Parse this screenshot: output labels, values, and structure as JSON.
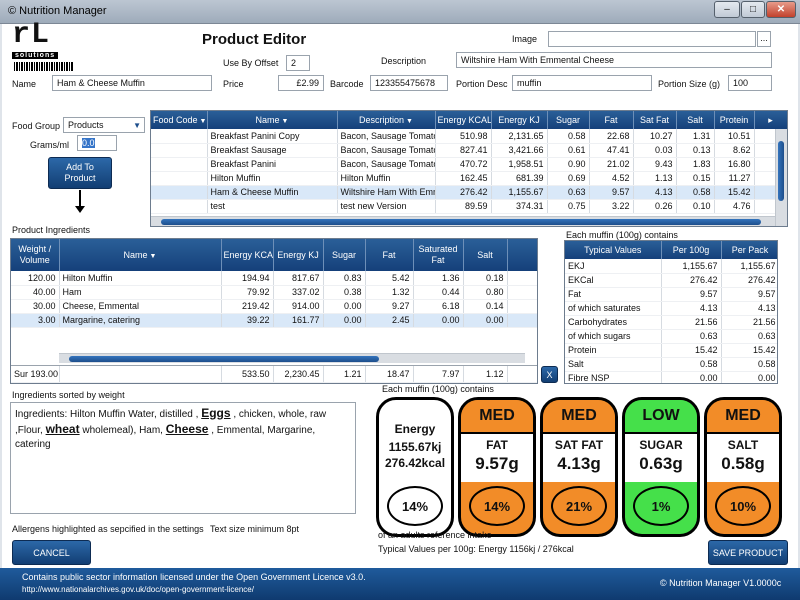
{
  "window": {
    "title": "© Nutrition Manager",
    "min": "–",
    "max": "□",
    "close": "✕"
  },
  "header": {
    "title": "Product Editor",
    "logo_main": "rL",
    "logo_sub": "solutions"
  },
  "form": {
    "image_label": "Image",
    "image_value": "",
    "image_btn": "...",
    "use_by_label": "Use By Offset",
    "use_by_value": "2",
    "description_label": "Description",
    "description_value": "Wiltshire Ham With Emmental Cheese",
    "name_label": "Name",
    "name_value": "Ham & Cheese Muffin",
    "price_label": "Price",
    "price_value": "£2.99",
    "barcode_label": "Barcode",
    "barcode_value": "123355475678",
    "portion_desc_label": "Portion Desc",
    "portion_desc_value": "muffin",
    "portion_size_label": "Portion Size (g)",
    "portion_size_value": "100",
    "food_group_label": "Food Group",
    "food_group_value": "Products",
    "grams_label": "Grams/ml",
    "grams_value": "0.0",
    "add_btn": "Add To Product"
  },
  "products_grid": {
    "columns": [
      "Food Code",
      "Name",
      "Description",
      "Energy KCAL",
      "Energy KJ",
      "Sugar",
      "Fat",
      "Sat Fat",
      "Salt",
      "Protein"
    ],
    "rows": [
      [
        "",
        "Breakfast Panini Copy",
        "Bacon, Sausage Tomato",
        "510.98",
        "2,131.65",
        "0.58",
        "22.68",
        "10.27",
        "1.31",
        "10.51"
      ],
      [
        "",
        "Breakfast Sausage",
        "Bacon, Sausage Tomato",
        "827.41",
        "3,421.66",
        "0.61",
        "47.41",
        "0.03",
        "0.13",
        "8.62"
      ],
      [
        "",
        "Breakfast Panini",
        "Bacon, Sausage Tomato",
        "470.72",
        "1,958.51",
        "0.90",
        "21.02",
        "9.43",
        "1.83",
        "16.80"
      ],
      [
        "",
        "Hilton Muffin",
        "Hilton Muffin",
        "162.45",
        "681.39",
        "0.69",
        "4.52",
        "1.13",
        "0.15",
        "11.27"
      ],
      [
        "",
        "Ham & Cheese Muffin",
        "Wiltshire Ham With Emn",
        "276.42",
        "1,155.67",
        "0.63",
        "9.57",
        "4.13",
        "0.58",
        "15.42"
      ],
      [
        "",
        "test",
        "test new Version",
        "89.59",
        "374.31",
        "0.75",
        "3.22",
        "0.26",
        "0.10",
        "4.76"
      ]
    ],
    "selected_row": 4
  },
  "ingredients": {
    "section_label": "Product Ingredients",
    "columns": [
      "Weight / Volume",
      "Name",
      "Energy KCAL",
      "Energy KJ",
      "Sugar",
      "Fat",
      "Saturated Fat",
      "Salt"
    ],
    "rows": [
      [
        "120.00",
        "Hilton Muffin",
        "194.94",
        "817.67",
        "0.83",
        "5.42",
        "1.36",
        "0.18"
      ],
      [
        "40.00",
        "Ham",
        "79.92",
        "337.02",
        "0.38",
        "1.32",
        "0.44",
        "0.80"
      ],
      [
        "30.00",
        "Cheese, Emmental",
        "219.42",
        "914.00",
        "0.00",
        "9.27",
        "6.18",
        "0.14"
      ],
      [
        "3.00",
        "Margarine, catering",
        "39.22",
        "161.77",
        "0.00",
        "2.45",
        "0.00",
        "0.00"
      ]
    ],
    "totals": [
      "Sur 193.00",
      "",
      "533.50",
      "2,230.45",
      "1.21",
      "18.47",
      "7.97",
      "1.12"
    ],
    "remove_btn": "X"
  },
  "typical": {
    "caption": "Each muffin (100g) contains",
    "columns": [
      "Typical Values",
      "Per 100g",
      "Per Pack"
    ],
    "rows": [
      [
        "EKJ",
        "1,155.67",
        "1,155.67"
      ],
      [
        "EKCal",
        "276.42",
        "276.42"
      ],
      [
        "Fat",
        "9.57",
        "9.57"
      ],
      [
        "of which saturates",
        "4.13",
        "4.13"
      ],
      [
        "Carbohydrates",
        "21.56",
        "21.56"
      ],
      [
        "of which sugars",
        "0.63",
        "0.63"
      ],
      [
        "Protein",
        "15.42",
        "15.42"
      ],
      [
        "Salt",
        "0.58",
        "0.58"
      ],
      [
        "Fibre NSP",
        "0.00",
        "0.00"
      ]
    ]
  },
  "sorted": {
    "label": "Ingredients sorted by weight",
    "t1": "Ingredients: Hilton Muffin Water, distilled ,",
    "eggs": "Eggs",
    "t2": ", chicken, whole, raw ,Flour,",
    "wheat": "wheat",
    "t3": " wholemeal), Ham,",
    "cheese": "Cheese",
    "t4": ", Emmental, Margarine, catering",
    "allergen_note": "Allergens highlighted as sepcified in the settings",
    "text_size_note": "Text size minimum 8pt"
  },
  "gda": {
    "caption": "Each muffin (100g) contains",
    "energy": {
      "title": "Energy",
      "kj": "1155.67kj",
      "kcal": "276.42kcal",
      "pct": "14%"
    },
    "items": [
      {
        "level": "MED",
        "name": "FAT",
        "value": "9.57g",
        "pct": "14%",
        "color": "#f28c28"
      },
      {
        "level": "MED",
        "name": "SAT FAT",
        "value": "4.13g",
        "pct": "21%",
        "color": "#f28c28"
      },
      {
        "level": "LOW",
        "name": "SUGAR",
        "value": "0.63g",
        "pct": "1%",
        "color": "#45e04a"
      },
      {
        "level": "MED",
        "name": "SALT",
        "value": "0.58g",
        "pct": "10%",
        "color": "#f28c28"
      }
    ],
    "ref_intake": "of an adults reference intake",
    "typical_line": "Typical Values per 100g: Energy 1156kj / 276kcal"
  },
  "buttons": {
    "cancel": "CANCEL",
    "save": "SAVE PRODUCT"
  },
  "footer": {
    "licence": "Contains public sector information licensed under the Open Government Licence v3.0.",
    "url": "http://www.nationalarchives.gov.uk/doc/open-government-licence/",
    "version": "© Nutrition Manager V1.0000c"
  }
}
